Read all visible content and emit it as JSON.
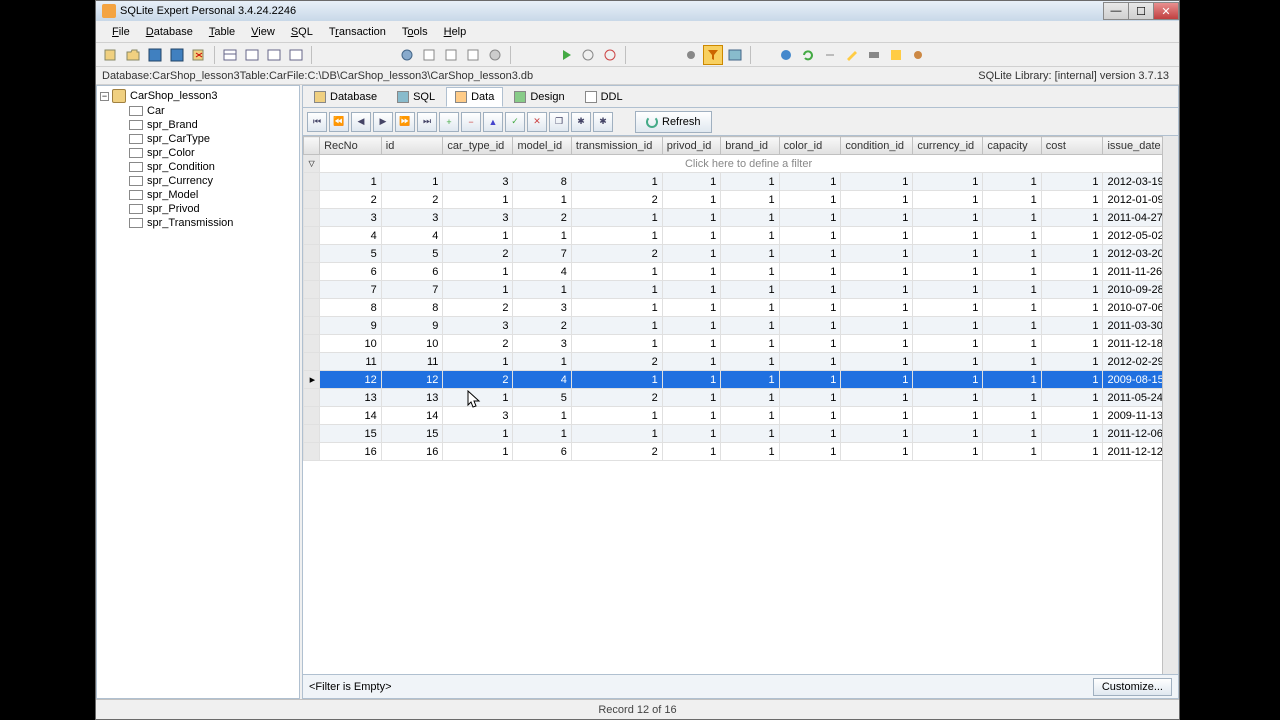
{
  "window": {
    "title": "SQLite Expert Personal 3.4.24.2246"
  },
  "menu": {
    "file": "File",
    "database": "Database",
    "table": "Table",
    "view": "View",
    "sql": "SQL",
    "transaction": "Transaction",
    "tools": "Tools",
    "help": "Help"
  },
  "status": {
    "database_label": "Database: ",
    "database": "CarShop_lesson3",
    "table_label": "   Table: ",
    "table": "Car",
    "file_label": "   File: ",
    "file": "C:\\DB\\CarShop_lesson3\\CarShop_lesson3.db",
    "library": "SQLite Library: [internal] version 3.7.13"
  },
  "tree": {
    "root": "CarShop_lesson3",
    "items": [
      "Car",
      "spr_Brand",
      "spr_CarType",
      "spr_Color",
      "spr_Condition",
      "spr_Currency",
      "spr_Model",
      "spr_Privod",
      "spr_Transmission"
    ]
  },
  "tabs": {
    "database": "Database",
    "sql": "SQL",
    "data": "Data",
    "design": "Design",
    "ddl": "DDL"
  },
  "nav": {
    "refresh": "Refresh"
  },
  "columns": [
    "RecNo",
    "id",
    "car_type_id",
    "model_id",
    "transmission_id",
    "privod_id",
    "brand_id",
    "color_id",
    "condition_id",
    "currency_id",
    "capacity",
    "cost",
    "issue_date"
  ],
  "filter_hint": "Click here to define a filter",
  "rows": [
    {
      "RecNo": 1,
      "id": 1,
      "car_type_id": 3,
      "model_id": 8,
      "transmission_id": 1,
      "privod_id": 1,
      "brand_id": 1,
      "color_id": 1,
      "condition_id": 1,
      "currency_id": 1,
      "capacity": 1,
      "cost": 1,
      "issue_date": "2012-03-19"
    },
    {
      "RecNo": 2,
      "id": 2,
      "car_type_id": 1,
      "model_id": 1,
      "transmission_id": 2,
      "privod_id": 1,
      "brand_id": 1,
      "color_id": 1,
      "condition_id": 1,
      "currency_id": 1,
      "capacity": 1,
      "cost": 1,
      "issue_date": "2012-01-09"
    },
    {
      "RecNo": 3,
      "id": 3,
      "car_type_id": 3,
      "model_id": 2,
      "transmission_id": 1,
      "privod_id": 1,
      "brand_id": 1,
      "color_id": 1,
      "condition_id": 1,
      "currency_id": 1,
      "capacity": 1,
      "cost": 1,
      "issue_date": "2011-04-27"
    },
    {
      "RecNo": 4,
      "id": 4,
      "car_type_id": 1,
      "model_id": 1,
      "transmission_id": 1,
      "privod_id": 1,
      "brand_id": 1,
      "color_id": 1,
      "condition_id": 1,
      "currency_id": 1,
      "capacity": 1,
      "cost": 1,
      "issue_date": "2012-05-02"
    },
    {
      "RecNo": 5,
      "id": 5,
      "car_type_id": 2,
      "model_id": 7,
      "transmission_id": 2,
      "privod_id": 1,
      "brand_id": 1,
      "color_id": 1,
      "condition_id": 1,
      "currency_id": 1,
      "capacity": 1,
      "cost": 1,
      "issue_date": "2012-03-20"
    },
    {
      "RecNo": 6,
      "id": 6,
      "car_type_id": 1,
      "model_id": 4,
      "transmission_id": 1,
      "privod_id": 1,
      "brand_id": 1,
      "color_id": 1,
      "condition_id": 1,
      "currency_id": 1,
      "capacity": 1,
      "cost": 1,
      "issue_date": "2011-11-26"
    },
    {
      "RecNo": 7,
      "id": 7,
      "car_type_id": 1,
      "model_id": 1,
      "transmission_id": 1,
      "privod_id": 1,
      "brand_id": 1,
      "color_id": 1,
      "condition_id": 1,
      "currency_id": 1,
      "capacity": 1,
      "cost": 1,
      "issue_date": "2010-09-28"
    },
    {
      "RecNo": 8,
      "id": 8,
      "car_type_id": 2,
      "model_id": 3,
      "transmission_id": 1,
      "privod_id": 1,
      "brand_id": 1,
      "color_id": 1,
      "condition_id": 1,
      "currency_id": 1,
      "capacity": 1,
      "cost": 1,
      "issue_date": "2010-07-06"
    },
    {
      "RecNo": 9,
      "id": 9,
      "car_type_id": 3,
      "model_id": 2,
      "transmission_id": 1,
      "privod_id": 1,
      "brand_id": 1,
      "color_id": 1,
      "condition_id": 1,
      "currency_id": 1,
      "capacity": 1,
      "cost": 1,
      "issue_date": "2011-03-30"
    },
    {
      "RecNo": 10,
      "id": 10,
      "car_type_id": 2,
      "model_id": 3,
      "transmission_id": 1,
      "privod_id": 1,
      "brand_id": 1,
      "color_id": 1,
      "condition_id": 1,
      "currency_id": 1,
      "capacity": 1,
      "cost": 1,
      "issue_date": "2011-12-18"
    },
    {
      "RecNo": 11,
      "id": 11,
      "car_type_id": 1,
      "model_id": 1,
      "transmission_id": 2,
      "privod_id": 1,
      "brand_id": 1,
      "color_id": 1,
      "condition_id": 1,
      "currency_id": 1,
      "capacity": 1,
      "cost": 1,
      "issue_date": "2012-02-29"
    },
    {
      "RecNo": 12,
      "id": 12,
      "car_type_id": 2,
      "model_id": 4,
      "transmission_id": 1,
      "privod_id": 1,
      "brand_id": 1,
      "color_id": 1,
      "condition_id": 1,
      "currency_id": 1,
      "capacity": 1,
      "cost": 1,
      "issue_date": "2009-08-15"
    },
    {
      "RecNo": 13,
      "id": 13,
      "car_type_id": 1,
      "model_id": 5,
      "transmission_id": 2,
      "privod_id": 1,
      "brand_id": 1,
      "color_id": 1,
      "condition_id": 1,
      "currency_id": 1,
      "capacity": 1,
      "cost": 1,
      "issue_date": "2011-05-24"
    },
    {
      "RecNo": 14,
      "id": 14,
      "car_type_id": 3,
      "model_id": 1,
      "transmission_id": 1,
      "privod_id": 1,
      "brand_id": 1,
      "color_id": 1,
      "condition_id": 1,
      "currency_id": 1,
      "capacity": 1,
      "cost": 1,
      "issue_date": "2009-11-13"
    },
    {
      "RecNo": 15,
      "id": 15,
      "car_type_id": 1,
      "model_id": 1,
      "transmission_id": 1,
      "privod_id": 1,
      "brand_id": 1,
      "color_id": 1,
      "condition_id": 1,
      "currency_id": 1,
      "capacity": 1,
      "cost": 1,
      "issue_date": "2011-12-06"
    },
    {
      "RecNo": 16,
      "id": 16,
      "car_type_id": 1,
      "model_id": 6,
      "transmission_id": 2,
      "privod_id": 1,
      "brand_id": 1,
      "color_id": 1,
      "condition_id": 1,
      "currency_id": 1,
      "capacity": 1,
      "cost": 1,
      "issue_date": "2011-12-12"
    }
  ],
  "selected_row": 11,
  "filter": {
    "text": "<Filter is Empty>",
    "customize": "Customize..."
  },
  "footer": {
    "record": "Record 12 of 16"
  }
}
